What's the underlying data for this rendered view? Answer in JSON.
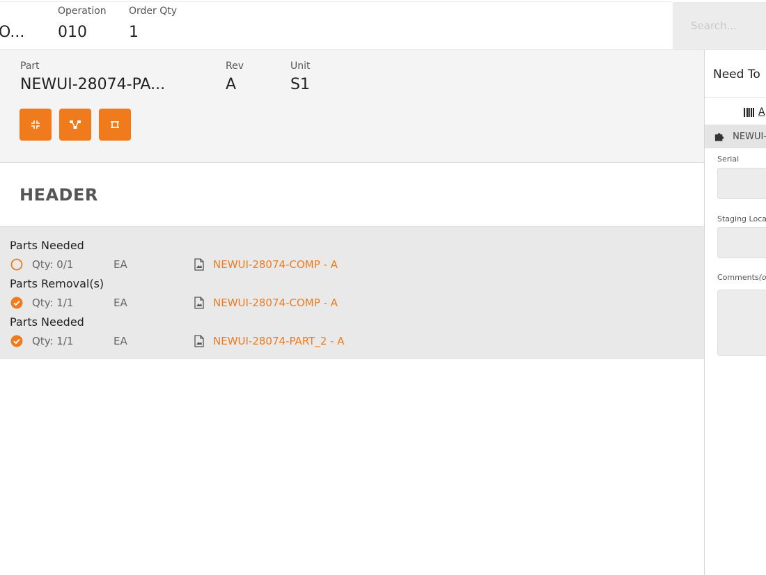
{
  "header_bar": {
    "order_value": "O...",
    "operation_label": "Operation",
    "operation_value": "010",
    "order_qty_label": "Order Qty",
    "order_qty_value": "1",
    "search_placeholder": "Search..."
  },
  "part_info": {
    "part_label": "Part",
    "part_value": "NEWUI-28074-PA...",
    "rev_label": "Rev",
    "rev_value": "A",
    "unit_label": "Unit",
    "unit_value": "S1",
    "action_icons": [
      "collapse-icon",
      "hierarchy-icon",
      "frame-icon"
    ]
  },
  "section": {
    "title": "HEADER"
  },
  "parts_groups": [
    {
      "title": "Parts Needed",
      "status": "pending",
      "qty": "Qty: 0/1",
      "uom": "EA",
      "part": "NEWUI-28074-COMP - A"
    },
    {
      "title": "Parts Removal(s)",
      "status": "complete",
      "qty": "Qty: 1/1",
      "uom": "EA",
      "part": "NEWUI-28074-COMP - A"
    },
    {
      "title": "Parts Needed",
      "status": "complete",
      "qty": "Qty: 1/1",
      "uom": "EA",
      "part": "NEWUI-28074-PART_2 - A"
    }
  ],
  "right_panel": {
    "title": "Need To",
    "tab_label": "A",
    "item_label": "NEWUI-",
    "serial_label": "Serial",
    "staging_label": "Staging Locat",
    "comments_label": "Comments",
    "comments_optional": "(op"
  },
  "colors": {
    "accent": "#f07b1d",
    "panel_bg": "#f4f4f4",
    "list_bg": "#e9e9e9"
  }
}
